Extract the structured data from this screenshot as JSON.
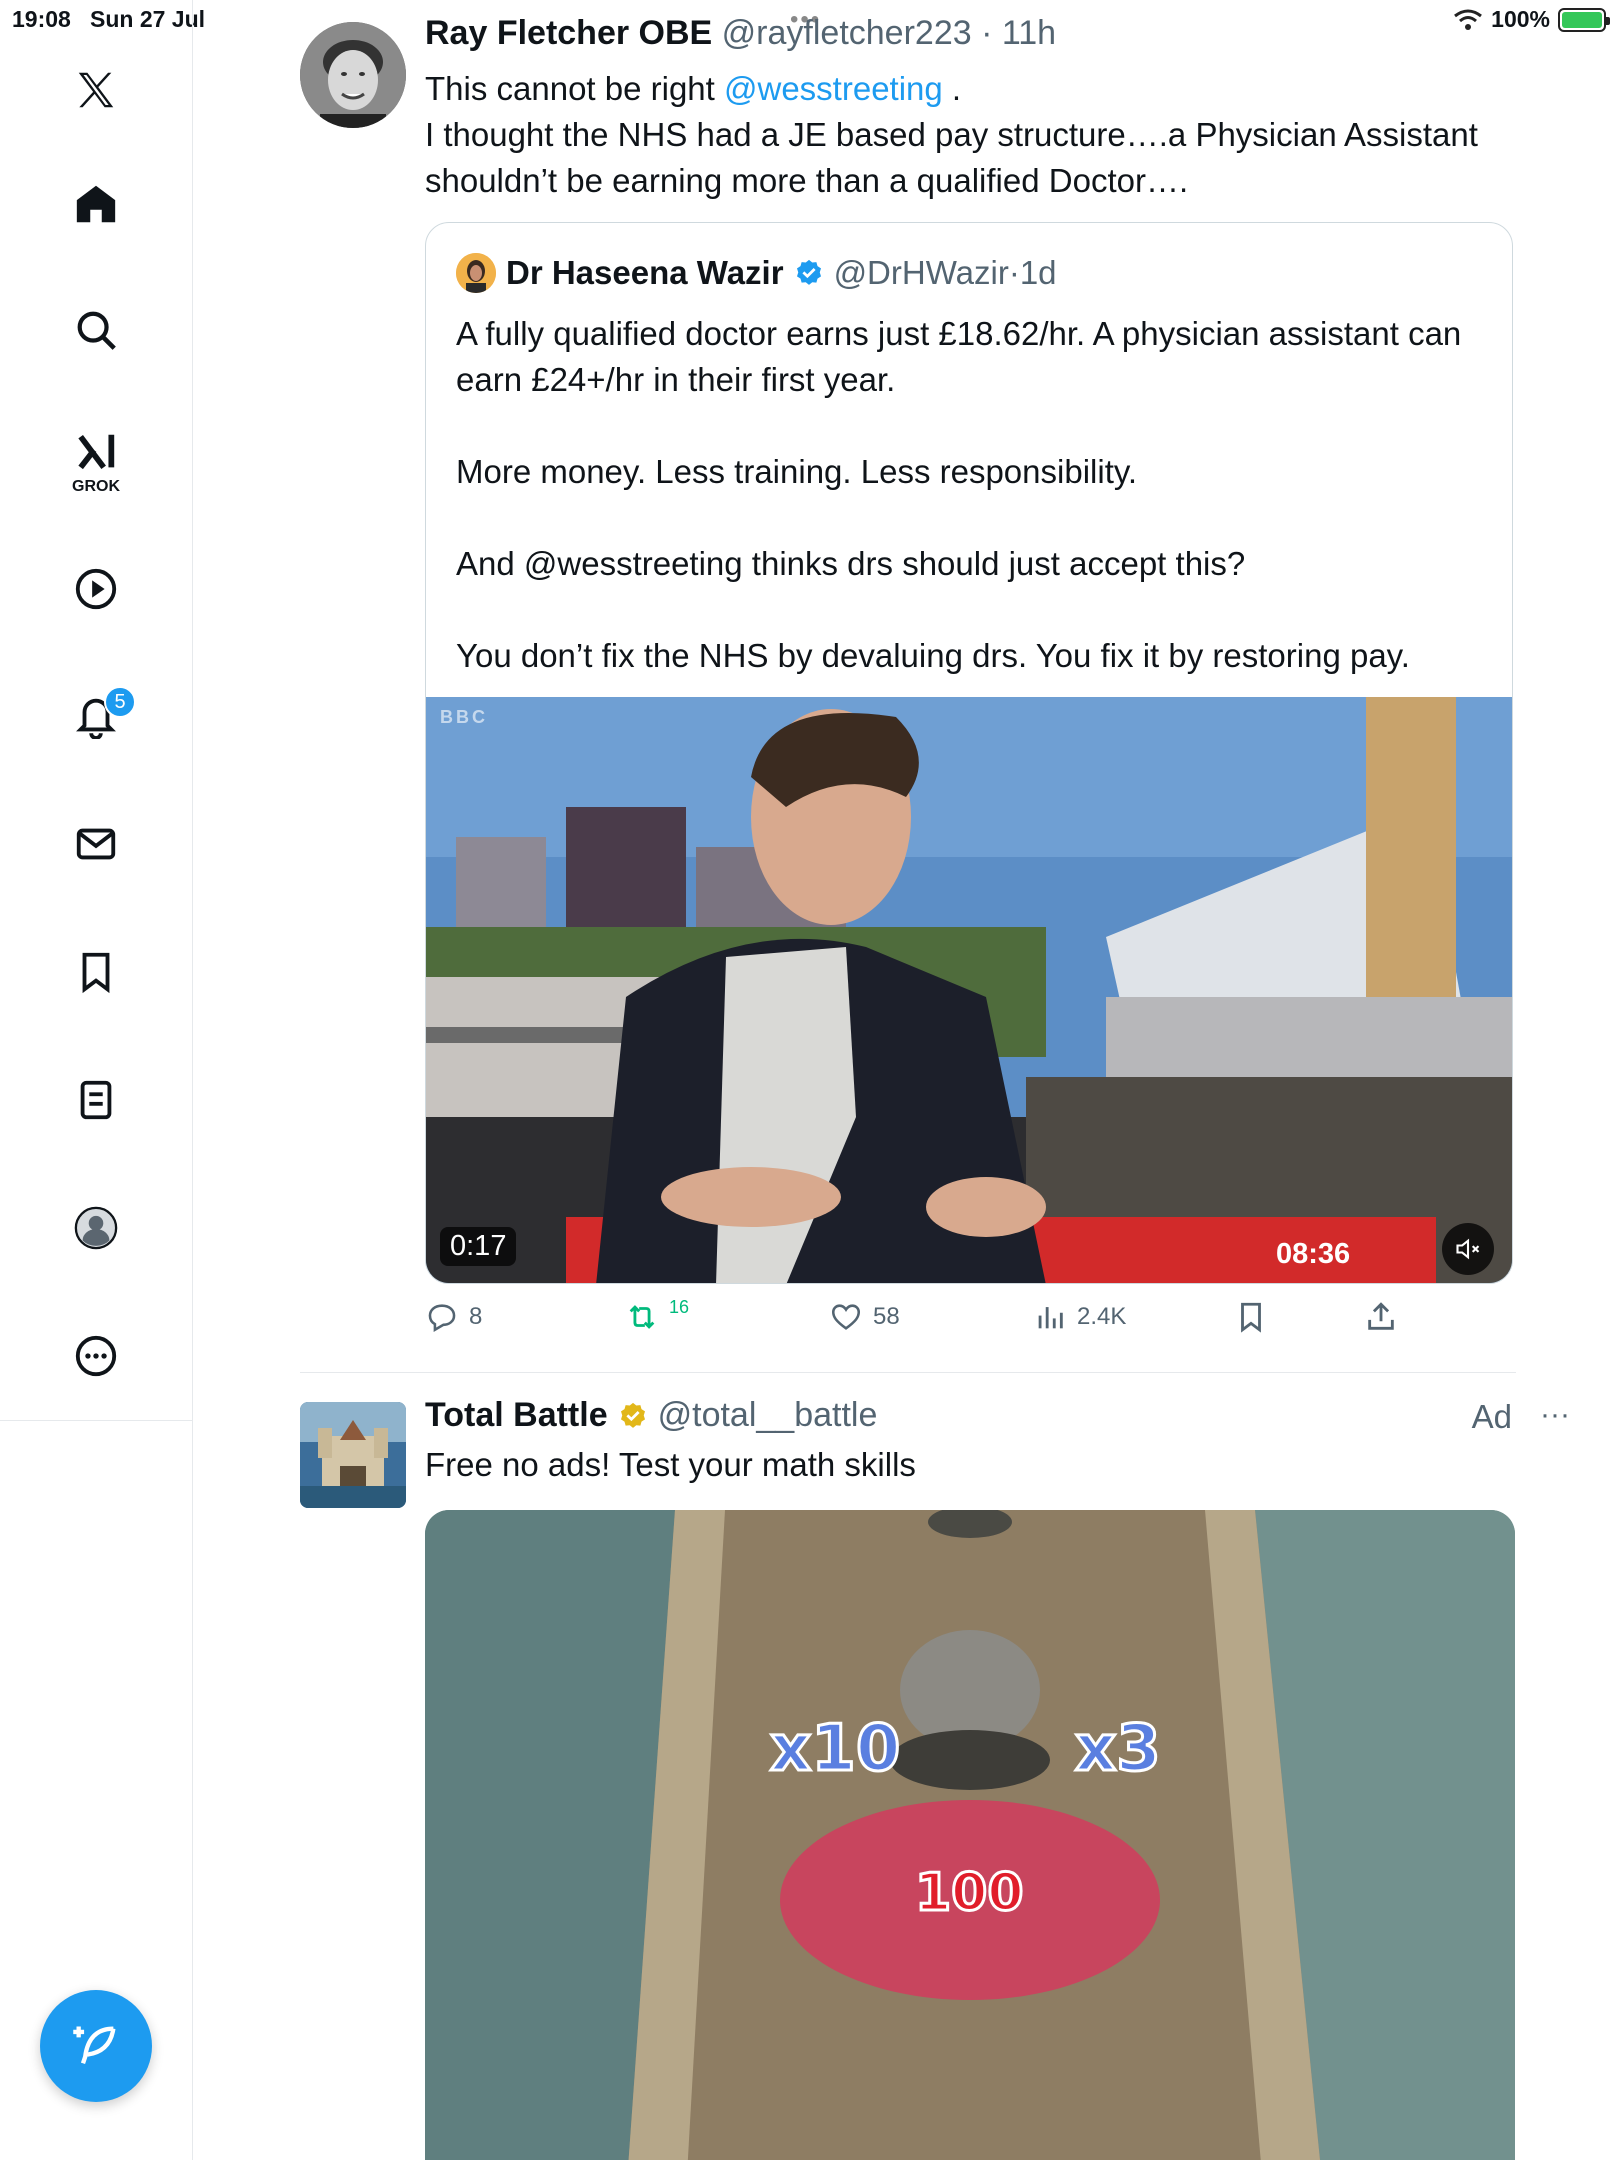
{
  "status": {
    "time": "19:08",
    "date": "Sun 27 Jul",
    "battery": "100%"
  },
  "sidebar": {
    "notifications_badge": "5",
    "grok_label": "GROK"
  },
  "tweet1": {
    "name": "Ray Fletcher OBE",
    "handle": "@rayfletcher223",
    "time": "11h",
    "line1_prefix": "This cannot be right ",
    "line1_mention": "@wesstreeting",
    "line1_suffix": " .",
    "line2": "I thought the NHS had a JE based pay structure….a Physician Assistant shouldn’t be earning more than a qualified Doctor….",
    "quote": {
      "name": "Dr Haseena Wazir",
      "handle": "@DrHWazir",
      "time": "1d",
      "p1": "A fully qualified doctor earns just £18.62/hr. A physician assistant can earn £24+/hr in their first year.",
      "p2": "More money. Less training. Less responsibility.",
      "p3": "And @wesstreeting thinks drs should just accept this?",
      "p4": "You don’t fix the NHS by devaluing drs. You fix it by restoring pay.",
      "video_elapsed": "0:17",
      "video_clock": "08:36",
      "channel_logo": "BBC"
    },
    "actions": {
      "replies": "8",
      "reposts": "16",
      "likes": "58",
      "views": "2.4K"
    }
  },
  "tweet2": {
    "name": "Total Battle",
    "handle": "@total__battle",
    "ad_label": "Ad",
    "text": "Free no ads! Test your math skills",
    "media": {
      "left_gate": "x10",
      "right_gate": "x3",
      "army_count": "100"
    }
  }
}
